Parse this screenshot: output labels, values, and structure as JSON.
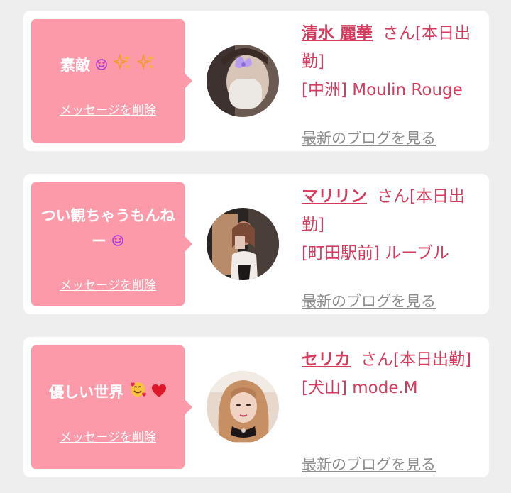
{
  "colors": {
    "background": "#efeeee",
    "card": "#ffffff",
    "bubble": "#fd9aaa",
    "accent": "#d63a5c",
    "link_gray": "#8c8c8c"
  },
  "cards": [
    {
      "message": "素敵",
      "message_icons": [
        "smiling-face-with-hearts-emoji",
        "sparkles-emoji",
        "sparkles-emoji"
      ],
      "delete_label": "メッセージを削除",
      "name": "清水 麗華",
      "suffix": "さん[本日出勤]",
      "shop": "[中洲] Moulin Rouge",
      "blog_label": "最新のブログを見る"
    },
    {
      "message": "つい観ちゃうもんねー",
      "message_icons": [
        "smiling-face-with-hearts-emoji"
      ],
      "delete_label": "メッセージを削除",
      "name": "マリリン",
      "suffix": "さん[本日出勤]",
      "shop": "[町田駅前] ルーブル",
      "blog_label": "最新のブログを見る"
    },
    {
      "message": "優しい世界",
      "message_icons": [
        "smiling-face-with-hearts-emoji",
        "red-heart-emoji"
      ],
      "delete_label": "メッセージを削除",
      "name": "セリカ",
      "suffix": "さん[本日出勤]",
      "shop": "[犬山] mode.M",
      "blog_label": "最新のブログを見る"
    }
  ]
}
